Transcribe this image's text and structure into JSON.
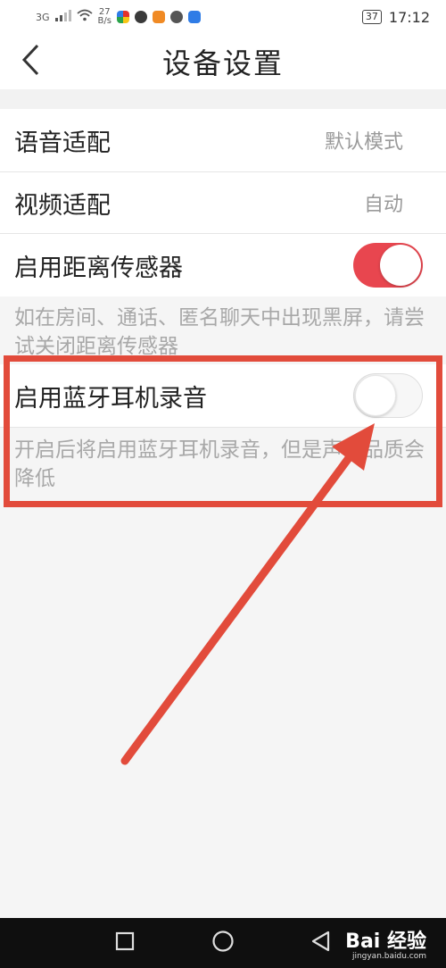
{
  "status_bar": {
    "signal": "3G",
    "speed_value": "27",
    "speed_unit": "B/s",
    "battery": "37",
    "time": "17:12"
  },
  "header": {
    "title": "设备设置",
    "back_icon": "chevron-left-icon"
  },
  "settings": {
    "voice_adapt": {
      "label": "语音适配",
      "value": "默认模式"
    },
    "video_adapt": {
      "label": "视频适配",
      "value": "自动"
    },
    "proximity_sensor": {
      "label": "启用距离传感器",
      "enabled": true,
      "description": "如在房间、通话、匿名聊天中出现黑屏，请尝试关闭距离传感器"
    },
    "bluetooth_recording": {
      "label": "启用蓝牙耳机录音",
      "enabled": false,
      "description": "开启后将启用蓝牙耳机录音，但是声音品质会降低"
    }
  },
  "nav_bar": {
    "recent_icon": "square-icon",
    "home_icon": "circle-icon",
    "back_icon": "triangle-back-icon"
  },
  "watermark": {
    "main": "Bai 经验",
    "sub": "jingyan.baidu.com"
  },
  "colors": {
    "accent": "#e8464f",
    "annotation": "#e24b3b"
  }
}
